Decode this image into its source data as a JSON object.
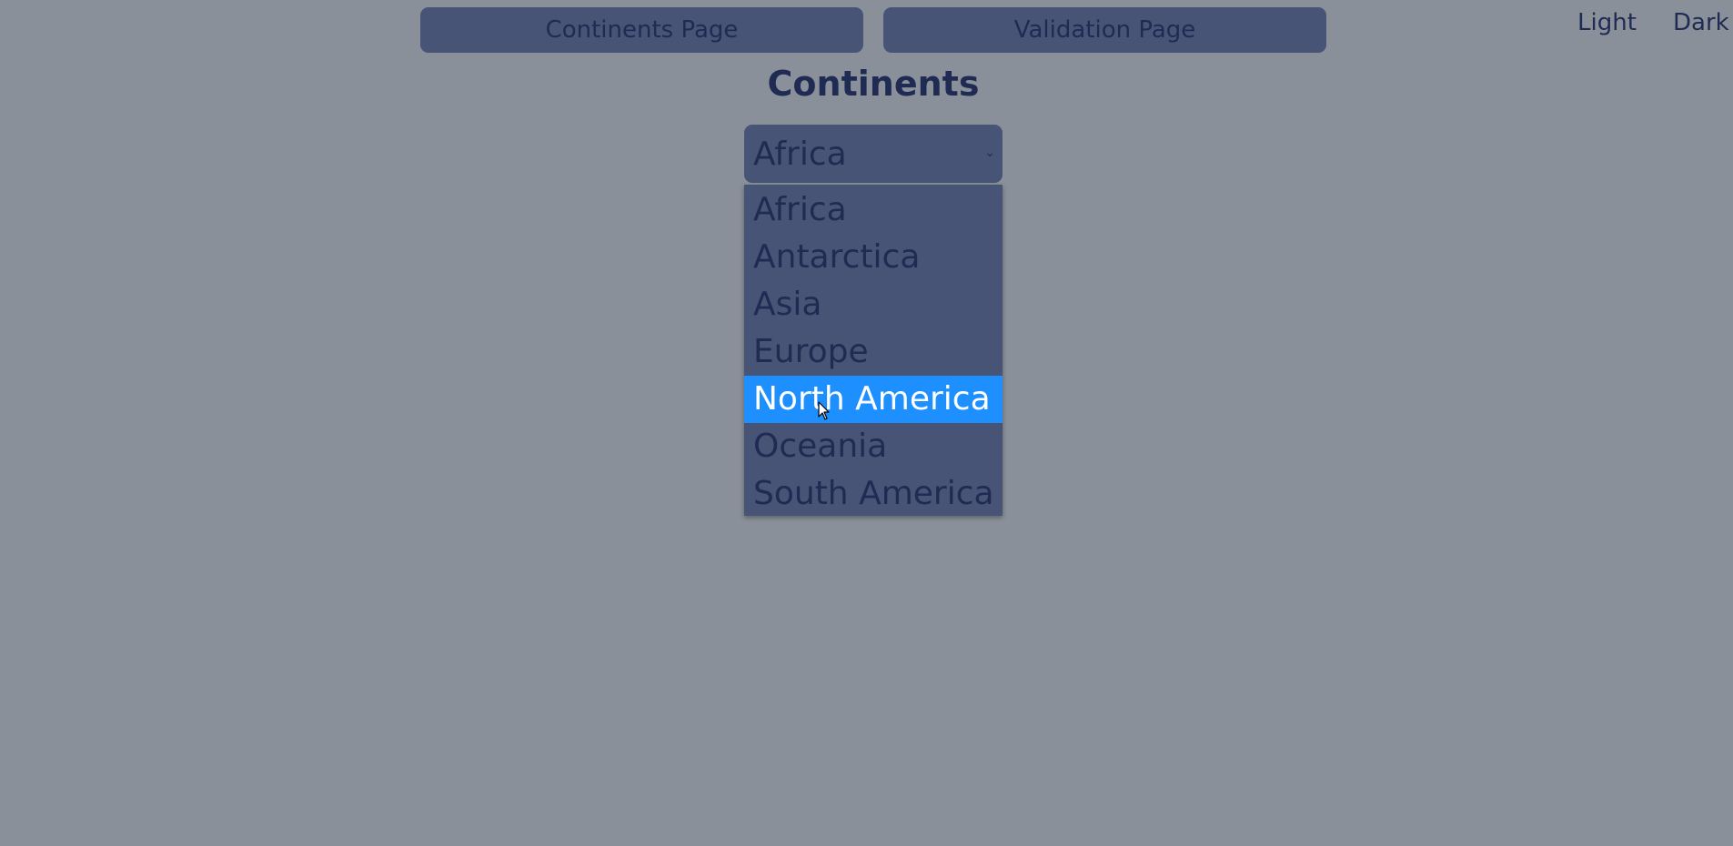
{
  "nav": {
    "continents_label": "Continents Page",
    "validation_label": "Validation Page"
  },
  "theme": {
    "light_label": "Light",
    "dark_label": "Dark"
  },
  "title": "Continents",
  "select": {
    "value": "Africa",
    "highlighted_option": "North America",
    "options": [
      "Africa",
      "Antarctica",
      "Asia",
      "Europe",
      "North America",
      "Oceania",
      "South America"
    ]
  },
  "colors": {
    "background": "#8a909a",
    "panel": "#475476",
    "text": "#1f2b52",
    "highlight": "#1e8fff"
  },
  "icons": {
    "select_chevron": "chevron-down-icon",
    "cursor": "mouse-pointer-icon"
  }
}
